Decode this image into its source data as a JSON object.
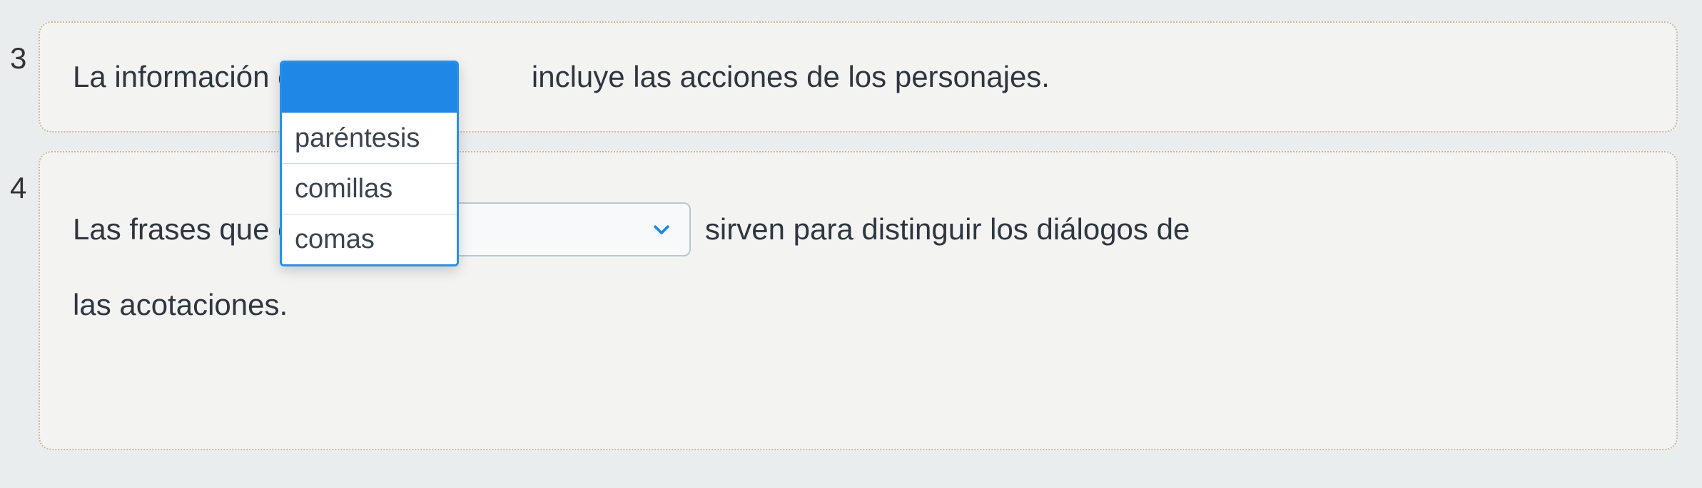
{
  "questions": {
    "q3": {
      "number": "3",
      "text_before": "La información entre",
      "text_after": "incluye las acciones de los personajes.",
      "dropdown": {
        "selected": "",
        "options": [
          "paréntesis",
          "comillas",
          "comas"
        ]
      }
    },
    "q4": {
      "number": "4",
      "text_before": "Las frases que están",
      "text_after": "sirven para distinguir los diálogos de",
      "text_line2": "las acotaciones.",
      "select": {
        "selected": ""
      }
    }
  }
}
